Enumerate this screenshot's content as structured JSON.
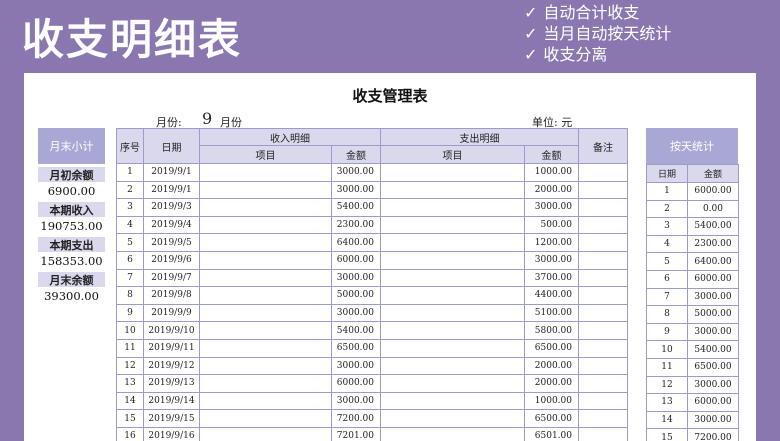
{
  "banner": {
    "title": "收支明细表",
    "features": [
      "自动合计收支",
      "当月自动按天统计",
      "收支分离"
    ]
  },
  "sheet": {
    "title": "收支管理表",
    "month_label": "月份:",
    "month_value": "9",
    "month_unit": "月份",
    "unit_text": "单位: 元"
  },
  "summary": {
    "header": "月末小计",
    "items": [
      {
        "label": "月初余额",
        "value": "6900.00"
      },
      {
        "label": "本期收入",
        "value": "190753.00"
      },
      {
        "label": "本期支出",
        "value": "158353.00"
      },
      {
        "label": "月末余额",
        "value": "39300.00"
      }
    ]
  },
  "table": {
    "headers": {
      "seq": "序号",
      "date": "日期",
      "income_group": "收入明细",
      "expense_group": "支出明细",
      "income_item": "项目",
      "income_amount": "金额",
      "expense_item": "项目",
      "expense_amount": "金额",
      "note": "备注"
    },
    "rows": [
      {
        "seq": "1",
        "date": "2019/9/1",
        "income_item": "",
        "income": "3000.00",
        "expense_item": "",
        "expense": "1000.00",
        "note": ""
      },
      {
        "seq": "2",
        "date": "2019/9/1",
        "income_item": "",
        "income": "3000.00",
        "expense_item": "",
        "expense": "2000.00",
        "note": ""
      },
      {
        "seq": "3",
        "date": "2019/9/3",
        "income_item": "",
        "income": "5400.00",
        "expense_item": "",
        "expense": "3000.00",
        "note": ""
      },
      {
        "seq": "4",
        "date": "2019/9/4",
        "income_item": "",
        "income": "2300.00",
        "expense_item": "",
        "expense": "500.00",
        "note": ""
      },
      {
        "seq": "5",
        "date": "2019/9/5",
        "income_item": "",
        "income": "6400.00",
        "expense_item": "",
        "expense": "1200.00",
        "note": ""
      },
      {
        "seq": "6",
        "date": "2019/9/6",
        "income_item": "",
        "income": "6000.00",
        "expense_item": "",
        "expense": "3000.00",
        "note": ""
      },
      {
        "seq": "7",
        "date": "2019/9/7",
        "income_item": "",
        "income": "3000.00",
        "expense_item": "",
        "expense": "3700.00",
        "note": ""
      },
      {
        "seq": "8",
        "date": "2019/9/8",
        "income_item": "",
        "income": "5000.00",
        "expense_item": "",
        "expense": "4400.00",
        "note": ""
      },
      {
        "seq": "9",
        "date": "2019/9/9",
        "income_item": "",
        "income": "3000.00",
        "expense_item": "",
        "expense": "5100.00",
        "note": ""
      },
      {
        "seq": "10",
        "date": "2019/9/10",
        "income_item": "",
        "income": "5400.00",
        "expense_item": "",
        "expense": "5800.00",
        "note": ""
      },
      {
        "seq": "11",
        "date": "2019/9/11",
        "income_item": "",
        "income": "6500.00",
        "expense_item": "",
        "expense": "6500.00",
        "note": ""
      },
      {
        "seq": "12",
        "date": "2019/9/12",
        "income_item": "",
        "income": "3000.00",
        "expense_item": "",
        "expense": "2000.00",
        "note": ""
      },
      {
        "seq": "13",
        "date": "2019/9/13",
        "income_item": "",
        "income": "6000.00",
        "expense_item": "",
        "expense": "2000.00",
        "note": ""
      },
      {
        "seq": "14",
        "date": "2019/9/14",
        "income_item": "",
        "income": "3000.00",
        "expense_item": "",
        "expense": "1000.00",
        "note": ""
      },
      {
        "seq": "15",
        "date": "2019/9/15",
        "income_item": "",
        "income": "7200.00",
        "expense_item": "",
        "expense": "6500.00",
        "note": ""
      },
      {
        "seq": "16",
        "date": "2019/9/16",
        "income_item": "",
        "income": "7201.00",
        "expense_item": "",
        "expense": "6501.00",
        "note": ""
      }
    ]
  },
  "daily": {
    "header": "按天统计",
    "col_date": "日期",
    "col_amount": "金额",
    "rows": [
      {
        "day": "1",
        "amount": "6000.00"
      },
      {
        "day": "2",
        "amount": "0.00"
      },
      {
        "day": "3",
        "amount": "5400.00"
      },
      {
        "day": "4",
        "amount": "2300.00"
      },
      {
        "day": "5",
        "amount": "6400.00"
      },
      {
        "day": "6",
        "amount": "6000.00"
      },
      {
        "day": "7",
        "amount": "3000.00"
      },
      {
        "day": "8",
        "amount": "5000.00"
      },
      {
        "day": "9",
        "amount": "3000.00"
      },
      {
        "day": "10",
        "amount": "5400.00"
      },
      {
        "day": "11",
        "amount": "6500.00"
      },
      {
        "day": "12",
        "amount": "3000.00"
      },
      {
        "day": "13",
        "amount": "6000.00"
      },
      {
        "day": "14",
        "amount": "3000.00"
      },
      {
        "day": "15",
        "amount": "7200.00"
      }
    ]
  },
  "colors": {
    "background": "#8b77b0",
    "header_fill": "#d9d8ed",
    "panel_header": "#a9a7d3",
    "grid_line": "#9c9cc8"
  }
}
